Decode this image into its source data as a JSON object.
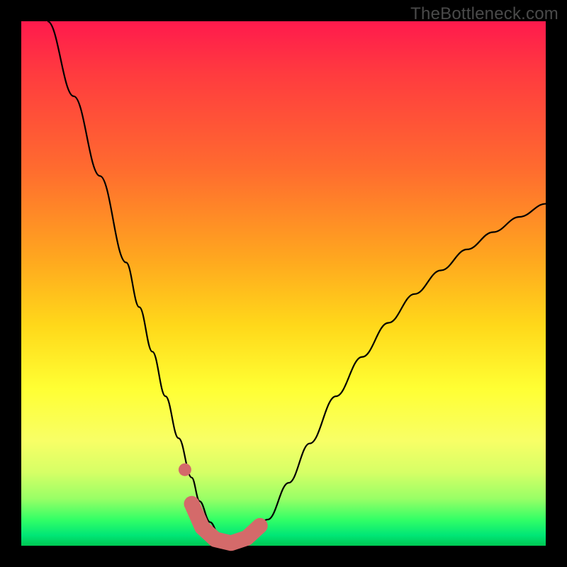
{
  "watermark": "TheBottleneck.com",
  "colors": {
    "curve_stroke": "#000000",
    "marker_stroke": "#d46a6a",
    "background_black": "#000000"
  },
  "chart_data": {
    "type": "line",
    "title": "",
    "xlabel": "",
    "ylabel": "",
    "xlim": [
      0,
      1
    ],
    "ylim": [
      0,
      1
    ],
    "series": [
      {
        "name": "bottleneck-curve",
        "x": [
          0.05,
          0.1,
          0.15,
          0.2,
          0.225,
          0.25,
          0.275,
          0.3,
          0.325,
          0.34,
          0.36,
          0.38,
          0.4,
          0.43,
          0.47,
          0.51,
          0.55,
          0.6,
          0.65,
          0.7,
          0.75,
          0.8,
          0.85,
          0.9,
          0.95,
          1.0
        ],
        "y": [
          1.0,
          0.857,
          0.705,
          0.54,
          0.455,
          0.37,
          0.285,
          0.205,
          0.13,
          0.085,
          0.045,
          0.015,
          0.005,
          0.01,
          0.05,
          0.12,
          0.195,
          0.285,
          0.36,
          0.425,
          0.48,
          0.525,
          0.565,
          0.598,
          0.627,
          0.652
        ]
      }
    ],
    "markers": [
      {
        "name": "highlight-valley",
        "type": "thick-path",
        "x": [
          0.325,
          0.345,
          0.37,
          0.4,
          0.43,
          0.455
        ],
        "y": [
          0.08,
          0.035,
          0.012,
          0.005,
          0.015,
          0.038
        ]
      },
      {
        "name": "highlight-dot",
        "type": "dot",
        "x": 0.312,
        "y": 0.145
      }
    ],
    "annotations": []
  }
}
